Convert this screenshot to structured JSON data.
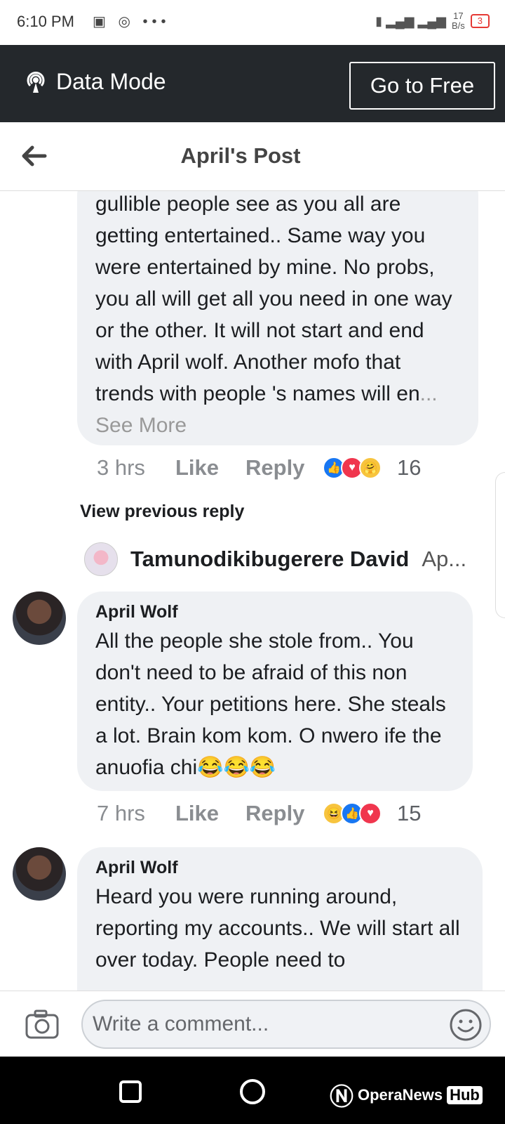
{
  "status_bar": {
    "time": "6:10 PM",
    "speed_top": "17",
    "speed_bottom": "B/s",
    "battery": "3"
  },
  "data_banner": {
    "label": "Data Mode",
    "button": "Go to Free"
  },
  "header": {
    "title": "April's Post"
  },
  "comments": [
    {
      "body": "gullible people see as you all are getting entertained.. Same way you were entertained by mine.  No probs,  you all will get all you need in one way or the other.  It will not start and end with April wolf. Another mofo that trends with people 's names will en",
      "ellipsis": "...",
      "see_more": "See More",
      "time": "3 hrs",
      "like": "Like",
      "reply": "Reply",
      "count": "16",
      "reactions": [
        "like-icon",
        "love-icon",
        "care-icon"
      ]
    },
    {
      "author": "April Wolf",
      "body": "All the people  she stole from.. You don't  need to be afraid of this non entity.. Your petitions here.  She steals a lot.  Brain kom kom.  O nwero ife the  anuofia chi😂😂😂",
      "time": "7 hrs",
      "like": "Like",
      "reply": "Reply",
      "count": "15",
      "reactions": [
        "haha-icon",
        "like-icon",
        "love-icon"
      ]
    },
    {
      "author": "April Wolf",
      "body": "Heard you were running around, reporting my accounts.. We will start all over today.  People  need to"
    }
  ],
  "view_previous": "View previous reply",
  "reply_preview": {
    "name": "Tamunodikibugerere David",
    "snippet": "Ap..."
  },
  "composer": {
    "placeholder": "Write a comment..."
  },
  "watermark": {
    "brand": "OperaNews",
    "hub": "Hub"
  }
}
